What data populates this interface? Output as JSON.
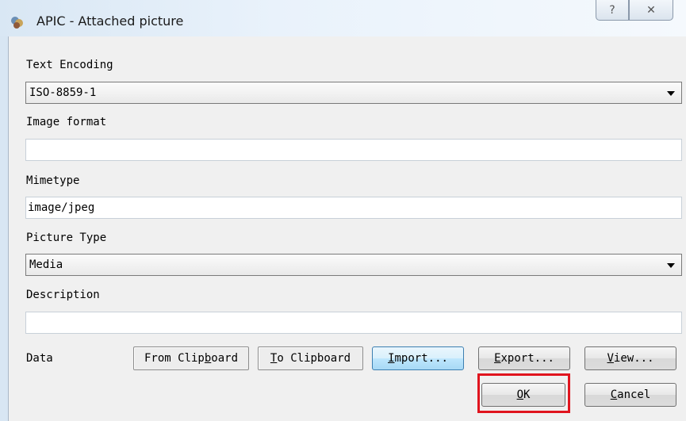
{
  "window": {
    "title": "APIC - Attached picture",
    "help_glyph": "?",
    "close_glyph": "✕"
  },
  "form": {
    "text_encoding_label": "Text Encoding",
    "text_encoding_value": "ISO-8859-1",
    "image_format_label": "Image format",
    "image_format_value": "",
    "mimetype_label": "Mimetype",
    "mimetype_value": "image/jpeg",
    "picture_type_label": "Picture Type",
    "picture_type_value": "Media",
    "description_label": "Description",
    "description_value": "",
    "data_label": "Data"
  },
  "buttons": {
    "from_clipboard_pre": "From Clip",
    "from_clipboard_u": "b",
    "from_clipboard_post": "oard",
    "to_clipboard_u": "T",
    "to_clipboard_post": "o Clipboard",
    "import_u": "I",
    "import_post": "mport...",
    "export_u": "E",
    "export_post": "xport...",
    "view_u": "V",
    "view_post": "iew...",
    "ok_u": "O",
    "ok_post": "K",
    "cancel_u": "C",
    "cancel_post": "ancel"
  },
  "colors": {
    "highlight": "#e0141e",
    "focus_border": "#3c7fb1"
  },
  "icons": {
    "app": "app-icon",
    "help": "help-icon",
    "close": "close-icon",
    "dropdown": "chevron-down-icon"
  }
}
